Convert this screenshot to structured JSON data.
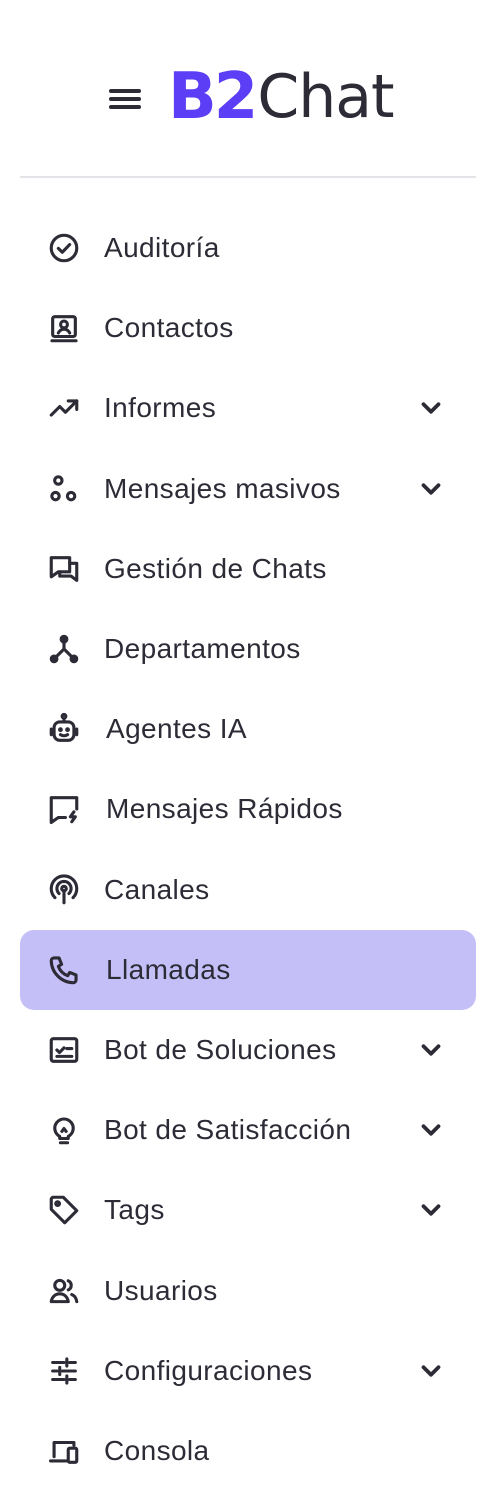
{
  "header": {
    "logo_brand": "B2",
    "logo_word": "Chat",
    "brand_color": "#5b3ef5",
    "menu_icon": "hamburger-menu-icon"
  },
  "sidebar": {
    "active_color": "#c4bff6",
    "items": [
      {
        "label": "Auditoría",
        "icon": "check-circle-icon",
        "expandable": false,
        "active": false
      },
      {
        "label": "Contactos",
        "icon": "contact-card-icon",
        "expandable": false,
        "active": false
      },
      {
        "label": "Informes",
        "icon": "trending-up-icon",
        "expandable": true,
        "active": false
      },
      {
        "label": "Mensajes masivos",
        "icon": "nodes-icon",
        "expandable": true,
        "active": false
      },
      {
        "label": "Gestión de Chats",
        "icon": "chat-bubbles-icon",
        "expandable": false,
        "active": false
      },
      {
        "label": "Departamentos",
        "icon": "org-branch-icon",
        "expandable": false,
        "active": false
      },
      {
        "label": "Agentes IA",
        "icon": "robot-icon",
        "expandable": false,
        "active": false
      },
      {
        "label": "Mensajes Rápidos",
        "icon": "quick-message-icon",
        "expandable": false,
        "active": false
      },
      {
        "label": "Canales",
        "icon": "broadcast-icon",
        "expandable": false,
        "active": false
      },
      {
        "label": "Llamadas",
        "icon": "phone-icon",
        "expandable": false,
        "active": true
      },
      {
        "label": "Bot de Soluciones",
        "icon": "checklist-icon",
        "expandable": true,
        "active": false
      },
      {
        "label": "Bot de Satisfacción",
        "icon": "lightbulb-icon",
        "expandable": true,
        "active": false
      },
      {
        "label": "Tags",
        "icon": "tag-icon",
        "expandable": true,
        "active": false
      },
      {
        "label": "Usuarios",
        "icon": "users-icon",
        "expandable": false,
        "active": false
      },
      {
        "label": "Configuraciones",
        "icon": "sliders-icon",
        "expandable": true,
        "active": false
      },
      {
        "label": "Consola",
        "icon": "devices-icon",
        "expandable": false,
        "active": false
      }
    ]
  }
}
